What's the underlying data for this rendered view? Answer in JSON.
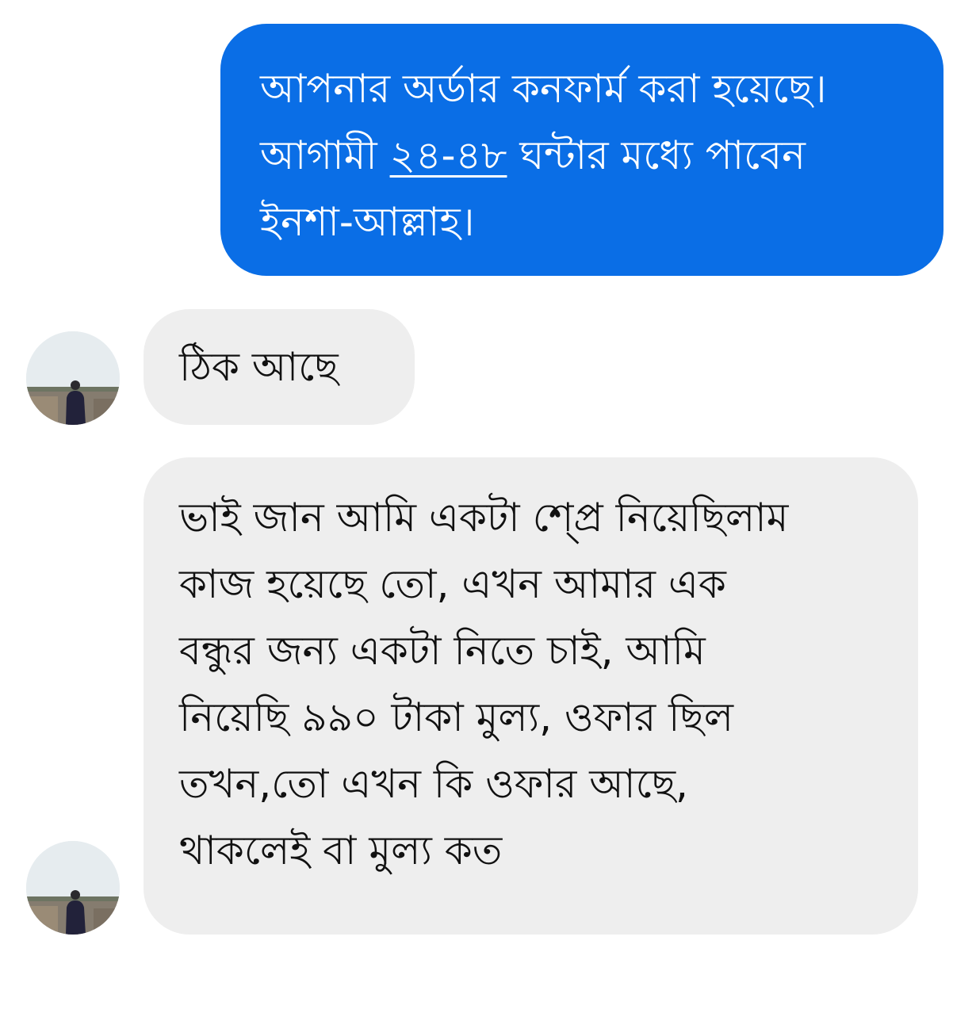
{
  "messages": [
    {
      "direction": "outgoing",
      "lines": [
        "আপনার অর্ডার কনফার্ম করা হয়েছে।",
        "আগামী ",
        "ইনশা-আল্লাহ।"
      ],
      "line2_link": "২৪-৪৮",
      "line2_tail": " ঘন্টার মধ্যে পাবেন"
    },
    {
      "direction": "incoming",
      "lines": [
        "ঠিক আছে"
      ]
    },
    {
      "direction": "incoming",
      "lines": [
        "ভাই জান আমি একটা শ্প্রে নিয়েছিলাম",
        "কাজ হয়েছে তো, এখন আমার এক",
        "বন্ধুর জন্য একটা নিতে চাই, আমি",
        "নিয়েছি ৯৯০ টাকা মুল্য, ওফার ছিল",
        "তখন,তো এখন কি ওফার আছে,",
        "থাকলেই বা মুল্য কত"
      ]
    }
  ],
  "colors": {
    "outgoing_bubble": "#0a6ee6",
    "incoming_bubble": "#eeeeee"
  },
  "icons": {
    "avatar": "contact-avatar-photo"
  }
}
